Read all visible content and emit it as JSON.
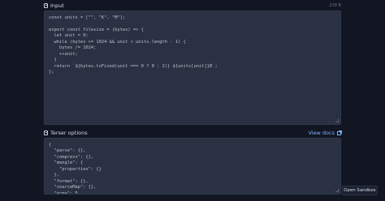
{
  "input_panel": {
    "title": "Input",
    "size": "239 B",
    "code": "const units = [\"\", \"K\", \"M\"];\n\nexport const filesize = (bytes) => {\n  let unit = 0;\n  while (bytes >= 1024 && unit < units.length - 1) {\n    bytes /= 1024;\n    ++unit;\n  }\n  return `${bytes.toFixed(unit === 0 ? 0 : 2)} ${units[unit]}B`;\n};"
  },
  "terser_panel": {
    "title": "Terser options",
    "docs_link": "View docs",
    "code": "{\n  \"parse\": {},\n  \"compress\": {},\n  \"mangle\": {\n    \"properties\": {}\n  },\n  \"format\": {},\n  \"sourceMap\": {},\n  \"ecma\": 5,"
  },
  "sandbox_button": "Open Sandbox"
}
